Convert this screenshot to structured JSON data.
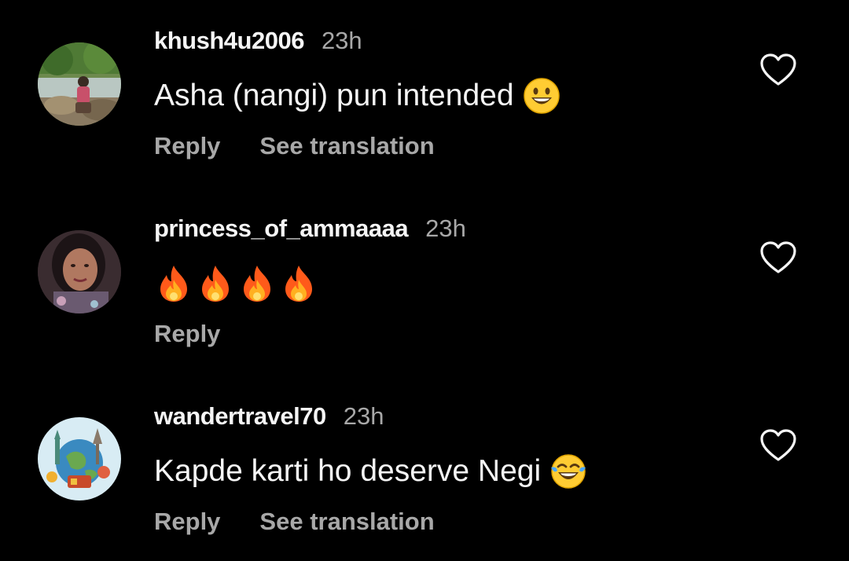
{
  "comments": [
    {
      "username": "khush4u2006",
      "time": "23h",
      "text": "Asha (nangi) pun intended",
      "emoji": "grinning-face-emoji",
      "reply_label": "Reply",
      "translate_label": "See translation",
      "avatar": "nature-photo-avatar"
    },
    {
      "username": "princess_of_ammaaaa",
      "time": "23h",
      "text_emojis": [
        "fire-emoji",
        "fire-emoji",
        "fire-emoji",
        "fire-emoji"
      ],
      "reply_label": "Reply",
      "avatar": "selfie-photo-avatar"
    },
    {
      "username": "wandertravel70",
      "time": "23h",
      "text": "Kapde karti ho deserve Negi",
      "emoji": "tears-of-joy-emoji",
      "reply_label": "Reply",
      "translate_label": "See translation",
      "avatar": "world-landmarks-avatar"
    }
  ],
  "colors": {
    "background": "#000000",
    "primary_text": "#f5f5f5",
    "secondary_text": "#a8a8a8"
  },
  "icons": {
    "like": "heart-outline-icon"
  }
}
